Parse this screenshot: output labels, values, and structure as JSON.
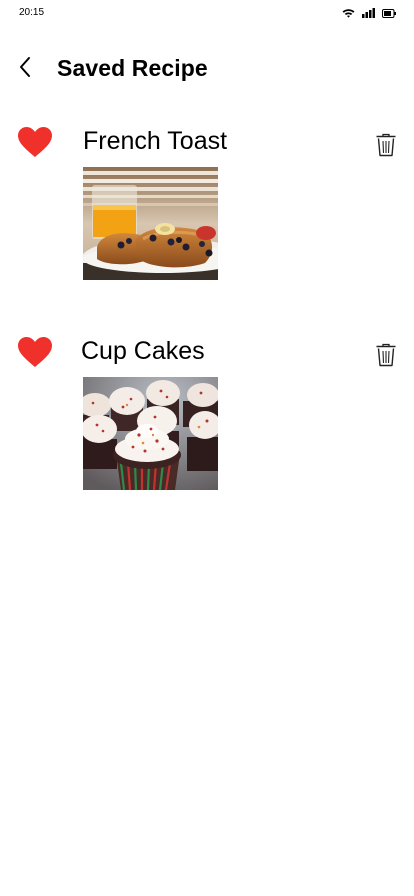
{
  "status_bar": {
    "time": "20:15",
    "icons": [
      "wifi-icon",
      "signal-icon",
      "battery-icon"
    ]
  },
  "header": {
    "back_icon": "chevron-left-icon",
    "title": "Saved Recipe"
  },
  "recipes": [
    {
      "name": "French Toast",
      "favorite_icon": "heart-icon",
      "delete_icon": "trash-icon",
      "photo": "french-toast-photo"
    },
    {
      "name": "Cup Cakes",
      "favorite_icon": "heart-icon",
      "delete_icon": "trash-icon",
      "photo": "cupcakes-photo"
    }
  ],
  "colors": {
    "heart": "#f0302a",
    "text": "#000000",
    "background": "#ffffff"
  }
}
